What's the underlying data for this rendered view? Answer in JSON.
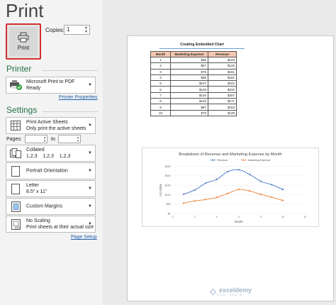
{
  "title": "Print",
  "print_button": {
    "label": "Print"
  },
  "copies": {
    "label": "Copies:",
    "value": "1"
  },
  "printer": {
    "heading": "Printer",
    "name": "Microsoft Print to PDF",
    "status": "Ready",
    "properties_link": "Printer Properties"
  },
  "settings": {
    "heading": "Settings",
    "what": {
      "line1": "Print Active Sheets",
      "line2": "Only print the active sheets"
    },
    "pages_label": "Pages:",
    "to_label": "to",
    "collated": {
      "line1": "Collated",
      "line2": "1,2,3    1,2,3    1,2,3"
    },
    "orientation": {
      "line1": "Portrait Orientation"
    },
    "paper": {
      "line1": "Letter",
      "line2": "8.5\" x 11\""
    },
    "margins": {
      "line1": "Custom Margins"
    },
    "scaling": {
      "line1": "No Scaling",
      "line2": "Print sheets at their actual size"
    },
    "page_setup_link": "Page Setup"
  },
  "preview": {
    "sheet_title": "Creating Embedded Chart",
    "table": {
      "headers": [
        "Month",
        "Marketing Expense",
        "Revenue"
      ],
      "rows": [
        [
          "1",
          "$56",
          "$103"
        ],
        [
          "2",
          "$67",
          "$125"
        ],
        [
          "3",
          "$75",
          "$161"
        ],
        [
          "4",
          "$86",
          "$181"
        ],
        [
          "5",
          "$107",
          "$222"
        ],
        [
          "6",
          "$128",
          "$232"
        ],
        [
          "7",
          "$120",
          "$207"
        ],
        [
          "8",
          "$102",
          "$171"
        ],
        [
          "9",
          "$87",
          "$153"
        ],
        [
          "10",
          "$70",
          "$128"
        ]
      ]
    },
    "logo_name": "exceldemy",
    "logo_sub": "EXCEL · DATA · BI"
  },
  "chart_data": {
    "type": "line",
    "title": "Breakdown of Revenue and Marketing Expense by Month",
    "xlabel": "Month",
    "ylabel": "US Dollar",
    "x": [
      1,
      2,
      3,
      4,
      5,
      6,
      7,
      8,
      9,
      10
    ],
    "xlim": [
      0,
      12
    ],
    "ylim": [
      0,
      250
    ],
    "x_ticks": [
      "0",
      "2",
      "4",
      "6",
      "8",
      "10",
      "12"
    ],
    "y_ticks": [
      "$0",
      "$50",
      "$100",
      "$150",
      "$200",
      "$250"
    ],
    "legend_position": "top",
    "series": [
      {
        "name": "Revenue",
        "color": "#4472c4",
        "values": [
          103,
          125,
          161,
          181,
          222,
          232,
          207,
          171,
          153,
          128
        ]
      },
      {
        "name": "Marketing Expense",
        "color": "#ed7d31",
        "values": [
          56,
          67,
          75,
          86,
          107,
          128,
          120,
          102,
          87,
          70
        ]
      }
    ]
  },
  "colors": {
    "accent": "#217346",
    "highlight": "#d32f2f",
    "link": "#1f5fa8"
  }
}
